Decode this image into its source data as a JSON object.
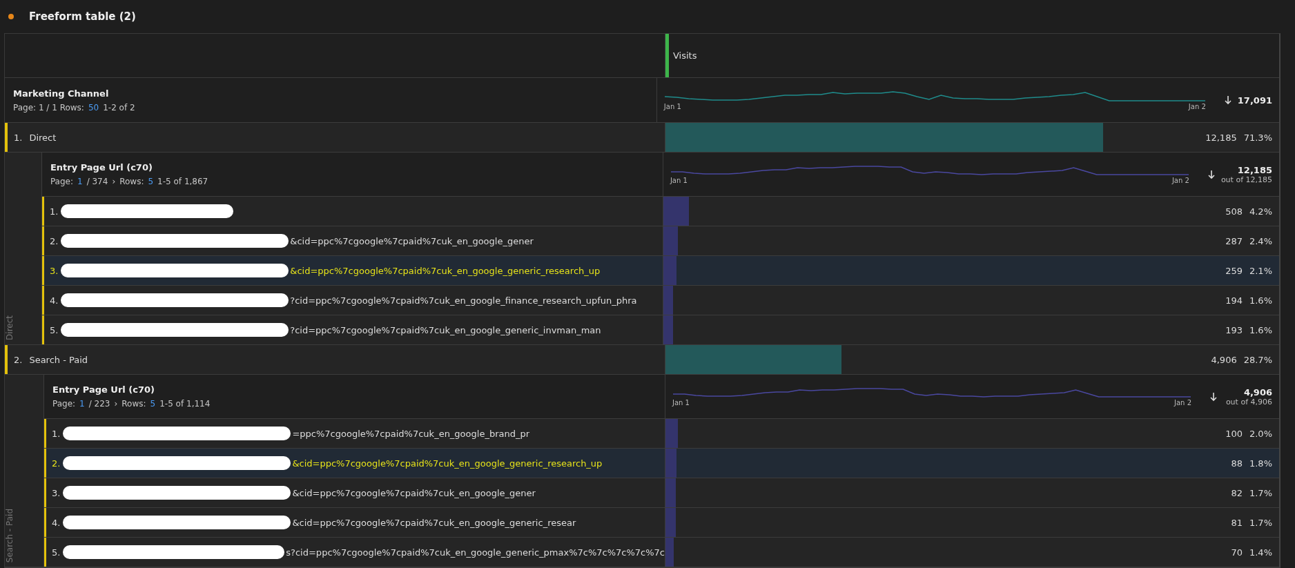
{
  "panel": {
    "title": "Freeform table (2)"
  },
  "table": {
    "metric_header": "Visits",
    "dimension": {
      "name": "Marketing Channel",
      "page_label": "Page: 1 / 1 Rows:",
      "rows_value": "50",
      "range": "1-2 of 2"
    },
    "summary": {
      "start": "Jan 1",
      "end": "Jan 2",
      "total": "17,091"
    },
    "groups": [
      {
        "index": "1.",
        "label": "Direct",
        "side_label": "Direct",
        "value": "12,185",
        "percent": "71.3%",
        "level": 0.713,
        "breakdown": {
          "name": "Entry Page Url (c70)",
          "page_label": "Page:",
          "page_current": "1",
          "page_total": "/ 374",
          "page_next": "›",
          "rows_label": "Rows:",
          "rows_value": "5",
          "range": "1-5 of 1,867",
          "start": "Jan 1",
          "end": "Jan 2",
          "total": "12,185",
          "total_note": "out of 12,185",
          "rows": [
            {
              "index": "1.",
              "highlighted": false,
              "value": "508",
              "percent": "4.2%",
              "level": 0.042
            },
            {
              "index": "2.",
              "url": "&cid=ppc%7cgoogle%7cpaid%7cuk_en_google_gener",
              "highlighted": false,
              "value": "287",
              "percent": "2.4%",
              "level": 0.024
            },
            {
              "index": "3.",
              "url": "&cid=ppc%7cgoogle%7cpaid%7cuk_en_google_generic_research_up",
              "highlighted": true,
              "value": "259",
              "percent": "2.1%",
              "level": 0.021
            },
            {
              "index": "4.",
              "url": "?cid=ppc%7cgoogle%7cpaid%7cuk_en_google_finance_research_upfun_phra",
              "highlighted": false,
              "value": "194",
              "percent": "1.6%",
              "level": 0.016
            },
            {
              "index": "5.",
              "url": "?cid=ppc%7cgoogle%7cpaid%7cuk_en_google_generic_invman_man",
              "highlighted": false,
              "value": "193",
              "percent": "1.6%",
              "level": 0.016
            }
          ]
        }
      },
      {
        "index": "2.",
        "label": "Search - Paid",
        "side_label": "Search - Paid",
        "value": "4,906",
        "percent": "28.7%",
        "level": 0.287,
        "breakdown": {
          "name": "Entry Page Url (c70)",
          "page_label": "Page:",
          "page_current": "1",
          "page_total": "/ 223",
          "page_next": "›",
          "rows_label": "Rows:",
          "rows_value": "5",
          "range": "1-5 of 1,114",
          "start": "Jan 1",
          "end": "Jan 2",
          "total": "4,906",
          "total_note": "out of 4,906",
          "rows": [
            {
              "index": "1.",
              "url": "=ppc%7cgoogle%7cpaid%7cuk_en_google_brand_pr",
              "highlighted": false,
              "value": "100",
              "percent": "2.0%",
              "level": 0.02
            },
            {
              "index": "2.",
              "url": "&cid=ppc%7cgoogle%7cpaid%7cuk_en_google_generic_research_up",
              "highlighted": true,
              "value": "88",
              "percent": "1.8%",
              "level": 0.018
            },
            {
              "index": "3.",
              "url": "&cid=ppc%7cgoogle%7cpaid%7cuk_en_google_gener",
              "highlighted": false,
              "value": "82",
              "percent": "1.7%",
              "level": 0.017
            },
            {
              "index": "4.",
              "url": "&cid=ppc%7cgoogle%7cpaid%7cuk_en_google_generic_resear",
              "highlighted": false,
              "value": "81",
              "percent": "1.7%",
              "level": 0.017
            },
            {
              "index": "5.",
              "url": "s?cid=ppc%7cgoogle%7cpaid%7cuk_en_google_generic_pmax%7c%7c%7c%7c%7c",
              "highlighted": false,
              "value": "70",
              "percent": "1.4%",
              "level": 0.014
            }
          ]
        }
      }
    ]
  }
}
